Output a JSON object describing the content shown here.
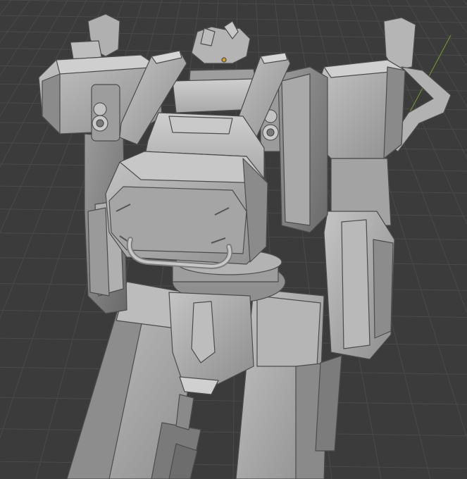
{
  "viewport": {
    "background_color": "#3b3b3b",
    "grid_color": "#4a4a4a",
    "axis_color": "#6f8f2f",
    "model_color": "#a6a6a6",
    "shadow_color": "#6e6e6e",
    "highlight_color": "#c8c8c8",
    "accent_color": "#d9a020"
  }
}
